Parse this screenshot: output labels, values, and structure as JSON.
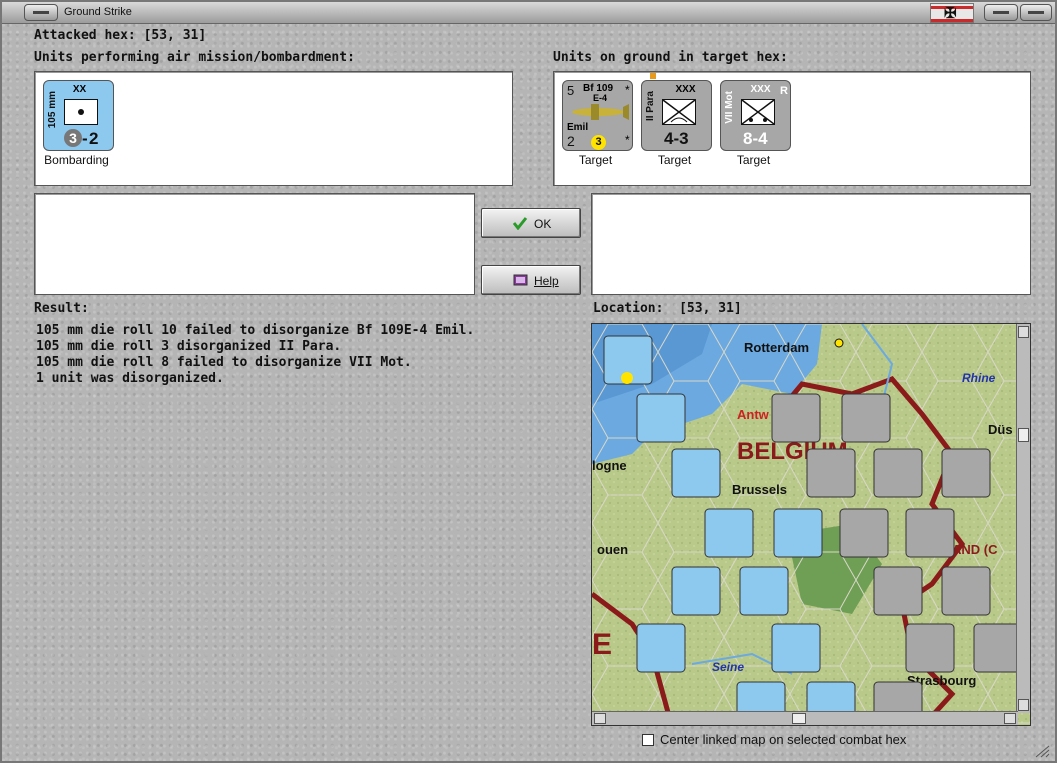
{
  "window": {
    "title": "Ground Strike"
  },
  "header": {
    "attacked_hex_label": "Attacked hex:",
    "attacked_hex_value": "[53, 31]"
  },
  "left_panel": {
    "title": "Units performing air mission/bombardment:",
    "units": [
      {
        "caption": "Bombarding",
        "designation": "105 mm",
        "echelon": "XX",
        "strength": "3",
        "moves": "2"
      }
    ]
  },
  "right_panel": {
    "title": "Units on ground in target hex:",
    "units": [
      {
        "caption": "Target",
        "type": "aircraft",
        "name": "Bf 109",
        "variant": "E-4",
        "pilot": "Emil",
        "top_left": "5",
        "bottom_left": "2",
        "badge": "3",
        "marks": "*"
      },
      {
        "caption": "Target",
        "type": "infantry",
        "designation": "II Para",
        "echelon": "XXX",
        "values": "4-3"
      },
      {
        "caption": "Target",
        "type": "motorized",
        "designation": "VII Mot",
        "echelon": "XXX",
        "flag": "R",
        "values": "8-4"
      }
    ]
  },
  "buttons": {
    "ok_label": "OK",
    "help_label": "Help"
  },
  "result": {
    "title": "Result:",
    "lines": [
      "105 mm die roll 10 failed to disorganize Bf 109E-4 Emil.",
      "105 mm die roll 3 disorganized II Para.",
      "105 mm die roll 8 failed to disorganize VII Mot.",
      "1 unit was disorganized."
    ]
  },
  "location": {
    "label": "Location:",
    "value": "[53, 31]",
    "map_labels": [
      "Rotterdam",
      "BELGIUM",
      "Brussels",
      "Antw",
      "Rhine",
      "Düs",
      "Seine",
      "Strasbourg",
      "logne",
      "ouen",
      "AND (C"
    ]
  },
  "footer": {
    "checkbox_label": "Center linked map on selected combat hex",
    "checkbox_checked": false
  },
  "colors": {
    "allied_unit": "#8dc8ee",
    "axis_unit": "#a7a7a7",
    "badge_yellow": "#ffe400",
    "border_red": "#8b1a1a"
  }
}
